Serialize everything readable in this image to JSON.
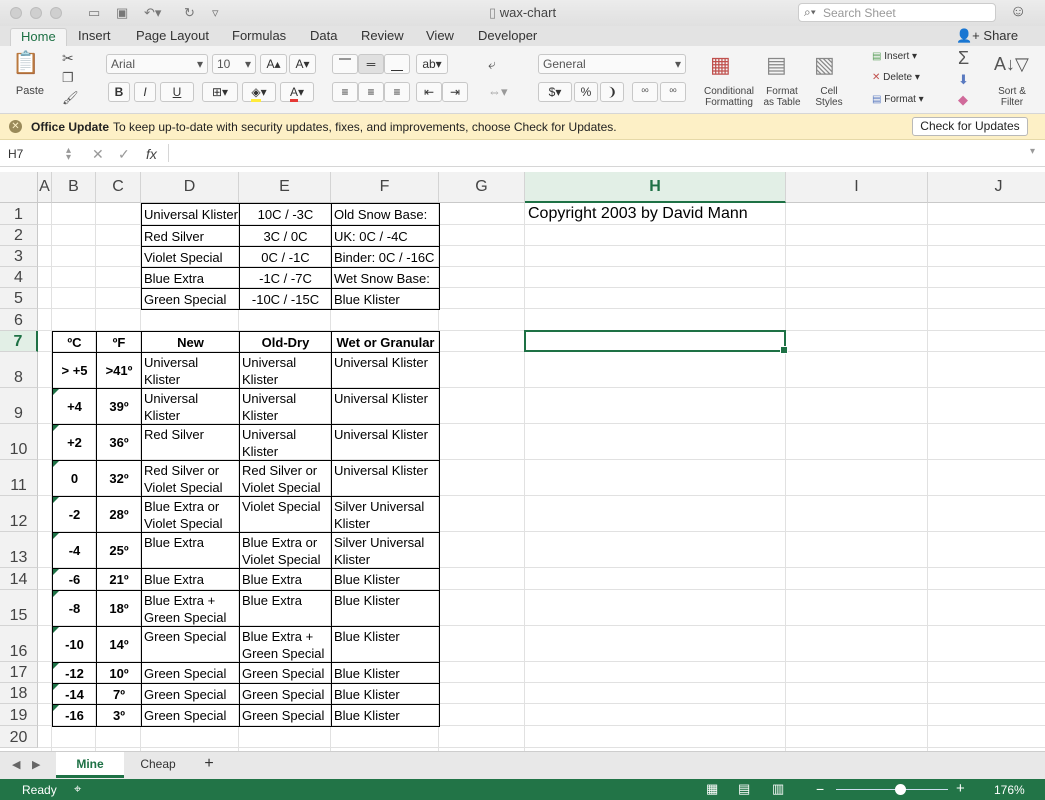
{
  "window": {
    "title": "wax-chart",
    "search_placeholder": "Search Sheet",
    "share_label": "Share"
  },
  "ribbon_tabs": [
    "Home",
    "Insert",
    "Page Layout",
    "Formulas",
    "Data",
    "Review",
    "View",
    "Developer"
  ],
  "ribbon": {
    "paste_label": "Paste",
    "font_name": "Arial",
    "font_size": "10",
    "number_format": "General",
    "conditional_formatting": "Conditional Formatting",
    "format_as_table": "Format as Table",
    "cell_styles": "Cell Styles",
    "insert_label": "Insert",
    "delete_label": "Delete",
    "format_label": "Format",
    "sort_filter": "Sort & Filter",
    "bold": "B",
    "italic": "I",
    "underline": "U",
    "currency": "$",
    "percent": "%"
  },
  "message_bar": {
    "title": "Office Update",
    "text": "To keep up-to-date with security updates, fixes, and improvements, choose Check for Updates.",
    "button": "Check for Updates"
  },
  "formula_bar": {
    "name_box": "H7",
    "fx": "fx",
    "content": ""
  },
  "columns": [
    "A",
    "B",
    "C",
    "D",
    "E",
    "F",
    "G",
    "H",
    "I",
    "J"
  ],
  "selected_column": "H",
  "rows": [
    "1",
    "2",
    "3",
    "4",
    "5",
    "6",
    "7",
    "8",
    "9",
    "10",
    "11",
    "12",
    "13",
    "14",
    "15",
    "16",
    "17",
    "18",
    "19",
    "20"
  ],
  "selected_row": "7",
  "cells": {
    "top_table": [
      [
        "Universal Klister",
        "10C / -3C",
        "Old Snow Base:"
      ],
      [
        "Red Silver",
        "3C  / 0C",
        "UK: 0C / -4C"
      ],
      [
        "Violet Special",
        "0C / -1C",
        "Binder: 0C / -16C"
      ],
      [
        "Blue Extra",
        "-1C / -7C",
        "Wet Snow Base:"
      ],
      [
        "Green Special",
        "-10C / -15C",
        "Blue Klister"
      ]
    ],
    "copyright": "Copyright 2003 by David Mann",
    "header": [
      "ºC",
      "ºF",
      "New",
      "Old-Dry",
      "Wet or Granular"
    ],
    "body": [
      [
        "> +5",
        ">41º",
        "Universal Klister",
        "Universal Klister",
        "Universal Klister"
      ],
      [
        "+4",
        "39º",
        "Universal Klister",
        "Universal Klister",
        "Universal Klister"
      ],
      [
        "+2",
        "36º",
        "Red Silver",
        "Universal Klister",
        "Universal Klister"
      ],
      [
        "0",
        "32º",
        "Red Silver or Violet Special",
        "Red Silver or Violet Special",
        "Universal Klister"
      ],
      [
        "-2",
        "28º",
        "Blue Extra or Violet Special",
        "Violet Special",
        "Silver Universal Klister"
      ],
      [
        "-4",
        "25º",
        "Blue Extra",
        "Blue Extra or Violet Special",
        "Silver Universal Klister"
      ],
      [
        "-6",
        "21º",
        "Blue Extra",
        "Blue Extra",
        "Blue Klister"
      ],
      [
        "-8",
        "18º",
        "Blue Extra + Green Special",
        "Blue Extra",
        "Blue Klister"
      ],
      [
        "-10",
        "14º",
        "Green Special",
        "Blue Extra + Green Special",
        "Blue Klister"
      ],
      [
        "-12",
        "10º",
        "Green Special",
        "Green Special",
        "Blue Klister"
      ],
      [
        "-14",
        "7º",
        "Green Special",
        "Green Special",
        "Blue Klister"
      ],
      [
        "-16",
        "3º",
        "Green Special",
        "Green Special",
        "Blue Klister"
      ]
    ]
  },
  "sheet_tabs": [
    "Mine",
    "Cheap"
  ],
  "add_sheet": "+",
  "status": {
    "ready": "Ready",
    "zoom_minus": "−",
    "zoom_plus": "+",
    "zoom": "176%"
  },
  "colors": {
    "accent": "#1e7145",
    "status_bar": "#227447",
    "message_bar": "#fdf0c6"
  }
}
